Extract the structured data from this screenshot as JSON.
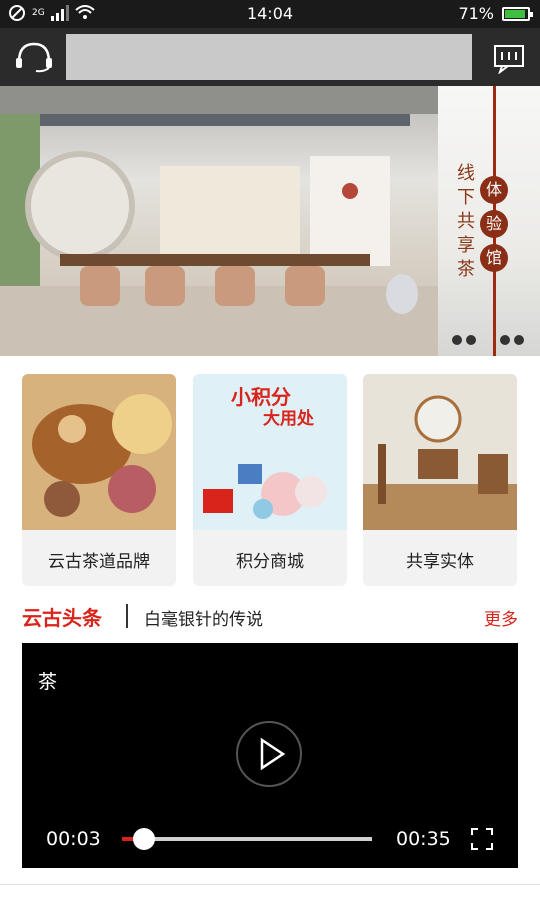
{
  "status": {
    "network": "2G",
    "time": "14:04",
    "battery": "71%"
  },
  "banner": {
    "side_text": "线下共享茶",
    "circles": [
      "体",
      "验",
      "馆"
    ]
  },
  "cards": [
    {
      "label": "云古茶道品牌"
    },
    {
      "label": "积分商城"
    },
    {
      "label": "共享实体"
    }
  ],
  "card2_art": {
    "line1": "小积分",
    "line2": "大用处"
  },
  "headline": {
    "brand": "云古头条",
    "news": "白毫银针的传说",
    "more": "更多"
  },
  "video": {
    "title": "茶",
    "current": "00:03",
    "total": "00:35",
    "progress": 0.086
  },
  "colors": {
    "accent": "#d9241b",
    "banner_red": "#8a2e15",
    "topbar": "#2b2b2b"
  }
}
